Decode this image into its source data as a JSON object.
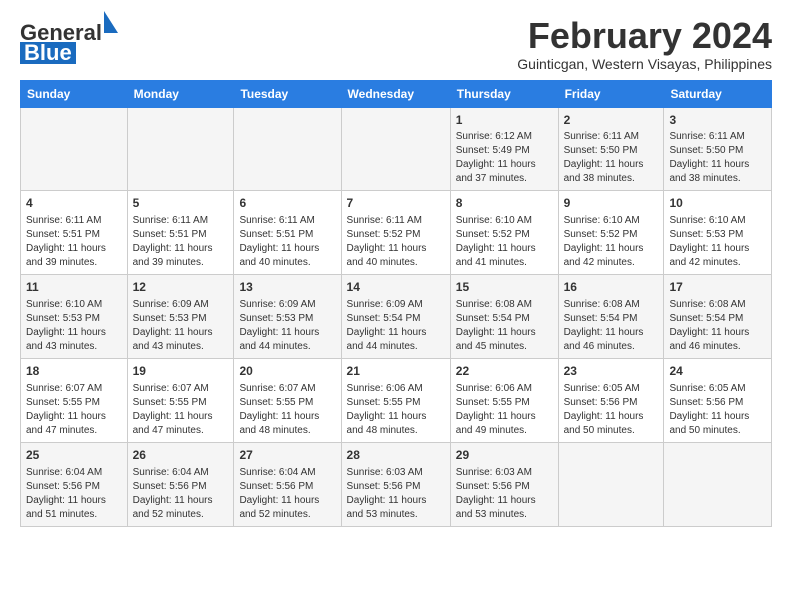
{
  "logo": {
    "text_general": "General",
    "text_blue": "Blue"
  },
  "title": {
    "month_year": "February 2024",
    "location": "Guinticgan, Western Visayas, Philippines"
  },
  "headers": [
    "Sunday",
    "Monday",
    "Tuesday",
    "Wednesday",
    "Thursday",
    "Friday",
    "Saturday"
  ],
  "weeks": [
    [
      {
        "day": "",
        "info": ""
      },
      {
        "day": "",
        "info": ""
      },
      {
        "day": "",
        "info": ""
      },
      {
        "day": "",
        "info": ""
      },
      {
        "day": "1",
        "info": "Sunrise: 6:12 AM\nSunset: 5:49 PM\nDaylight: 11 hours and 37 minutes."
      },
      {
        "day": "2",
        "info": "Sunrise: 6:11 AM\nSunset: 5:50 PM\nDaylight: 11 hours and 38 minutes."
      },
      {
        "day": "3",
        "info": "Sunrise: 6:11 AM\nSunset: 5:50 PM\nDaylight: 11 hours and 38 minutes."
      }
    ],
    [
      {
        "day": "4",
        "info": "Sunrise: 6:11 AM\nSunset: 5:51 PM\nDaylight: 11 hours and 39 minutes."
      },
      {
        "day": "5",
        "info": "Sunrise: 6:11 AM\nSunset: 5:51 PM\nDaylight: 11 hours and 39 minutes."
      },
      {
        "day": "6",
        "info": "Sunrise: 6:11 AM\nSunset: 5:51 PM\nDaylight: 11 hours and 40 minutes."
      },
      {
        "day": "7",
        "info": "Sunrise: 6:11 AM\nSunset: 5:52 PM\nDaylight: 11 hours and 40 minutes."
      },
      {
        "day": "8",
        "info": "Sunrise: 6:10 AM\nSunset: 5:52 PM\nDaylight: 11 hours and 41 minutes."
      },
      {
        "day": "9",
        "info": "Sunrise: 6:10 AM\nSunset: 5:52 PM\nDaylight: 11 hours and 42 minutes."
      },
      {
        "day": "10",
        "info": "Sunrise: 6:10 AM\nSunset: 5:53 PM\nDaylight: 11 hours and 42 minutes."
      }
    ],
    [
      {
        "day": "11",
        "info": "Sunrise: 6:10 AM\nSunset: 5:53 PM\nDaylight: 11 hours and 43 minutes."
      },
      {
        "day": "12",
        "info": "Sunrise: 6:09 AM\nSunset: 5:53 PM\nDaylight: 11 hours and 43 minutes."
      },
      {
        "day": "13",
        "info": "Sunrise: 6:09 AM\nSunset: 5:53 PM\nDaylight: 11 hours and 44 minutes."
      },
      {
        "day": "14",
        "info": "Sunrise: 6:09 AM\nSunset: 5:54 PM\nDaylight: 11 hours and 44 minutes."
      },
      {
        "day": "15",
        "info": "Sunrise: 6:08 AM\nSunset: 5:54 PM\nDaylight: 11 hours and 45 minutes."
      },
      {
        "day": "16",
        "info": "Sunrise: 6:08 AM\nSunset: 5:54 PM\nDaylight: 11 hours and 46 minutes."
      },
      {
        "day": "17",
        "info": "Sunrise: 6:08 AM\nSunset: 5:54 PM\nDaylight: 11 hours and 46 minutes."
      }
    ],
    [
      {
        "day": "18",
        "info": "Sunrise: 6:07 AM\nSunset: 5:55 PM\nDaylight: 11 hours and 47 minutes."
      },
      {
        "day": "19",
        "info": "Sunrise: 6:07 AM\nSunset: 5:55 PM\nDaylight: 11 hours and 47 minutes."
      },
      {
        "day": "20",
        "info": "Sunrise: 6:07 AM\nSunset: 5:55 PM\nDaylight: 11 hours and 48 minutes."
      },
      {
        "day": "21",
        "info": "Sunrise: 6:06 AM\nSunset: 5:55 PM\nDaylight: 11 hours and 48 minutes."
      },
      {
        "day": "22",
        "info": "Sunrise: 6:06 AM\nSunset: 5:55 PM\nDaylight: 11 hours and 49 minutes."
      },
      {
        "day": "23",
        "info": "Sunrise: 6:05 AM\nSunset: 5:56 PM\nDaylight: 11 hours and 50 minutes."
      },
      {
        "day": "24",
        "info": "Sunrise: 6:05 AM\nSunset: 5:56 PM\nDaylight: 11 hours and 50 minutes."
      }
    ],
    [
      {
        "day": "25",
        "info": "Sunrise: 6:04 AM\nSunset: 5:56 PM\nDaylight: 11 hours and 51 minutes."
      },
      {
        "day": "26",
        "info": "Sunrise: 6:04 AM\nSunset: 5:56 PM\nDaylight: 11 hours and 52 minutes."
      },
      {
        "day": "27",
        "info": "Sunrise: 6:04 AM\nSunset: 5:56 PM\nDaylight: 11 hours and 52 minutes."
      },
      {
        "day": "28",
        "info": "Sunrise: 6:03 AM\nSunset: 5:56 PM\nDaylight: 11 hours and 53 minutes."
      },
      {
        "day": "29",
        "info": "Sunrise: 6:03 AM\nSunset: 5:56 PM\nDaylight: 11 hours and 53 minutes."
      },
      {
        "day": "",
        "info": ""
      },
      {
        "day": "",
        "info": ""
      }
    ]
  ]
}
